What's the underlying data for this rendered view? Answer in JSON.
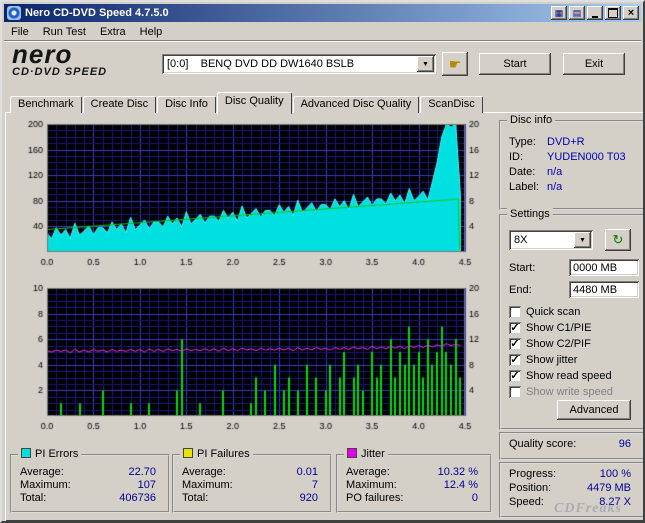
{
  "window": {
    "title": "Nero CD-DVD Speed 4.7.5.0"
  },
  "icons": {
    "dropdown_arrow": "▼",
    "hand": "☛",
    "refresh": "↻",
    "close": "×",
    "grid": "▦",
    "list": "▤"
  },
  "menu": {
    "items": [
      {
        "label": "File"
      },
      {
        "label": "Run Test"
      },
      {
        "label": "Extra"
      },
      {
        "label": "Help"
      }
    ]
  },
  "toolbar": {
    "logo_top": "nero",
    "logo_bottom": "CD·DVD SPEED",
    "drive_value": "[0:0]    BENQ DVD DD DW1640 BSLB",
    "start": "Start",
    "exit": "Exit"
  },
  "tabs": {
    "active": "Disc Quality",
    "items": [
      {
        "label": "Benchmark"
      },
      {
        "label": "Create Disc"
      },
      {
        "label": "Disc Info"
      },
      {
        "label": "Disc Quality"
      },
      {
        "label": "Advanced Disc Quality"
      },
      {
        "label": "ScanDisc"
      }
    ]
  },
  "disc_info": {
    "title": "Disc info",
    "type_label": "Type:",
    "type_value": "DVD+R",
    "id_label": "ID:",
    "id_value": "YUDEN000 T03",
    "date_label": "Date:",
    "date_value": "n/a",
    "label_label": "Label:",
    "label_value": "n/a"
  },
  "settings": {
    "title": "Settings",
    "speed_value": "8X",
    "start_label": "Start:",
    "start_value": "0000 MB",
    "end_label": "End:",
    "end_value": "4480 MB",
    "checkboxes": [
      {
        "label": "Quick scan",
        "mark": ""
      },
      {
        "label": "Show C1/PIE",
        "mark": "✓"
      },
      {
        "label": "Show C2/PIF",
        "mark": "✓"
      },
      {
        "label": "Show jitter",
        "mark": "✓"
      },
      {
        "label": "Show read speed",
        "mark": "✓"
      },
      {
        "label": "Show write speed",
        "mark": ""
      }
    ],
    "advanced": "Advanced"
  },
  "quality": {
    "label": "Quality score:",
    "value": "96"
  },
  "progress": {
    "rows": [
      {
        "label": "Progress:",
        "value": "100 %"
      },
      {
        "label": "Position:",
        "value": "4479 MB"
      },
      {
        "label": "Speed:",
        "value": "8.27 X"
      }
    ]
  },
  "stats": [
    {
      "title": "PI Errors",
      "color": "#00dede",
      "rows": [
        {
          "label": "Average:",
          "value": "22.70"
        },
        {
          "label": "Maximum:",
          "value": "107"
        },
        {
          "label": "Total:",
          "value": "406736"
        }
      ]
    },
    {
      "title": "PI Failures",
      "color": "#e6e600",
      "rows": [
        {
          "label": "Average:",
          "value": "0.01"
        },
        {
          "label": "Maximum:",
          "value": "7"
        },
        {
          "label": "Total:",
          "value": "920"
        }
      ]
    },
    {
      "title": "Jitter",
      "color": "#e600e6",
      "rows": [
        {
          "label": "Average:",
          "value": "10.32 %"
        },
        {
          "label": "Maximum:",
          "value": "12.4 %"
        },
        {
          "label": "PO failures:",
          "value": "0"
        }
      ]
    }
  ],
  "watermark": "CDFreaks",
  "chart_data": [
    {
      "type": "area",
      "x_min": 0,
      "x_max": 4.5,
      "x_tick_step": 0.5,
      "grid_minor_x": 0.1,
      "grid_major_x": 0.5,
      "left_axis": {
        "min": 0,
        "max": 200,
        "labels": [
          40,
          80,
          120,
          160,
          200
        ],
        "grid_minor": 10,
        "grid_major": 40
      },
      "right_axis": {
        "min": 0,
        "max": 20,
        "labels": [
          4,
          8,
          12,
          16,
          20
        ]
      },
      "series": [
        {
          "name": "PI Errors",
          "kind": "area",
          "axis": "left",
          "color": "#00e0e0",
          "edge": "#40ffff",
          "x_step": 0.05,
          "values": [
            29,
            21,
            38,
            26,
            35,
            21,
            45,
            26,
            33,
            41,
            27,
            38,
            38,
            30,
            47,
            35,
            44,
            30,
            54,
            35,
            42,
            50,
            36,
            47,
            47,
            39,
            56,
            44,
            53,
            39,
            63,
            44,
            51,
            59,
            45,
            56,
            56,
            48,
            65,
            53,
            62,
            48,
            72,
            53,
            60,
            68,
            54,
            65,
            65,
            57,
            74,
            62,
            71,
            57,
            81,
            62,
            69,
            77,
            63,
            74,
            74,
            66,
            83,
            71,
            80,
            66,
            90,
            71,
            78,
            86,
            72,
            83,
            83,
            75,
            92,
            80,
            89,
            75,
            99,
            80,
            87,
            95,
            81,
            110,
            140,
            180,
            200,
            195,
            200,
            90
          ]
        },
        {
          "name": "Read speed",
          "kind": "line",
          "axis": "right",
          "color": "#00c818",
          "points": [
            [
              0,
              3.5
            ],
            [
              4.43,
              8.27
            ],
            [
              4.44,
              0.4
            ]
          ]
        }
      ]
    },
    {
      "type": "bar",
      "x_min": 0,
      "x_max": 4.5,
      "x_tick_step": 0.5,
      "grid_minor_x": 0.1,
      "grid_major_x": 0.5,
      "left_axis": {
        "min": 0,
        "max": 10,
        "labels": [
          2,
          4,
          6,
          8,
          10
        ],
        "grid_minor": 0.5,
        "grid_major": 2
      },
      "right_axis": {
        "min": 0,
        "max": 20,
        "labels": [
          4,
          8,
          12,
          16,
          20
        ]
      },
      "series": [
        {
          "name": "PI Failures",
          "kind": "bars",
          "axis": "left",
          "color": "#00dc00",
          "x_step": 0.05,
          "values": [
            0,
            0,
            0,
            1,
            0,
            0,
            0,
            1,
            0,
            0,
            0,
            0,
            2,
            0,
            0,
            0,
            0,
            0,
            1,
            0,
            0,
            0,
            1,
            0,
            0,
            0,
            0,
            0,
            2,
            6,
            0,
            0,
            0,
            1,
            0,
            0,
            0,
            0,
            2,
            0,
            0,
            0,
            0,
            0,
            1,
            3,
            0,
            2,
            0,
            4,
            0,
            2,
            3,
            0,
            2,
            0,
            4,
            0,
            3,
            0,
            2,
            4,
            0,
            3,
            5,
            0,
            3,
            4,
            2,
            0,
            5,
            3,
            4,
            0,
            6,
            3,
            5,
            4,
            7,
            4,
            5,
            3,
            6,
            4,
            5,
            7,
            5,
            4,
            6,
            3
          ]
        },
        {
          "name": "Jitter",
          "kind": "line",
          "axis": "right",
          "color": "#f030f0",
          "x_step": 0.05,
          "values": [
            10.2,
            10.0,
            10.3,
            10.1,
            10.3,
            9.9,
            10.4,
            10.0,
            10.3,
            10.0,
            10.4,
            10.1,
            10.3,
            10.0,
            10.4,
            10.1,
            10.3,
            10.1,
            10.4,
            10.1,
            10.4,
            10.0,
            10.5,
            10.1,
            10.4,
            10.1,
            10.5,
            10.2,
            10.4,
            10.1,
            10.5,
            10.2,
            10.4,
            10.2,
            10.5,
            10.2,
            10.5,
            10.1,
            10.6,
            10.2,
            10.5,
            10.2,
            10.6,
            10.3,
            10.5,
            10.2,
            10.6,
            10.3,
            10.5,
            10.3,
            10.6,
            10.3,
            10.6,
            10.2,
            10.7,
            10.3,
            10.6,
            10.3,
            10.7,
            10.4,
            10.6,
            10.3,
            10.7,
            10.4,
            10.7,
            10.4,
            10.8,
            10.5,
            10.7,
            10.4,
            10.9,
            10.5,
            10.8,
            10.5,
            10.9,
            10.6,
            10.9,
            10.5,
            11.0,
            10.7,
            11.0,
            10.7,
            11.1,
            10.8,
            11.1,
            10.9,
            11.3,
            11.0,
            11.2,
            11.0
          ]
        }
      ]
    }
  ]
}
